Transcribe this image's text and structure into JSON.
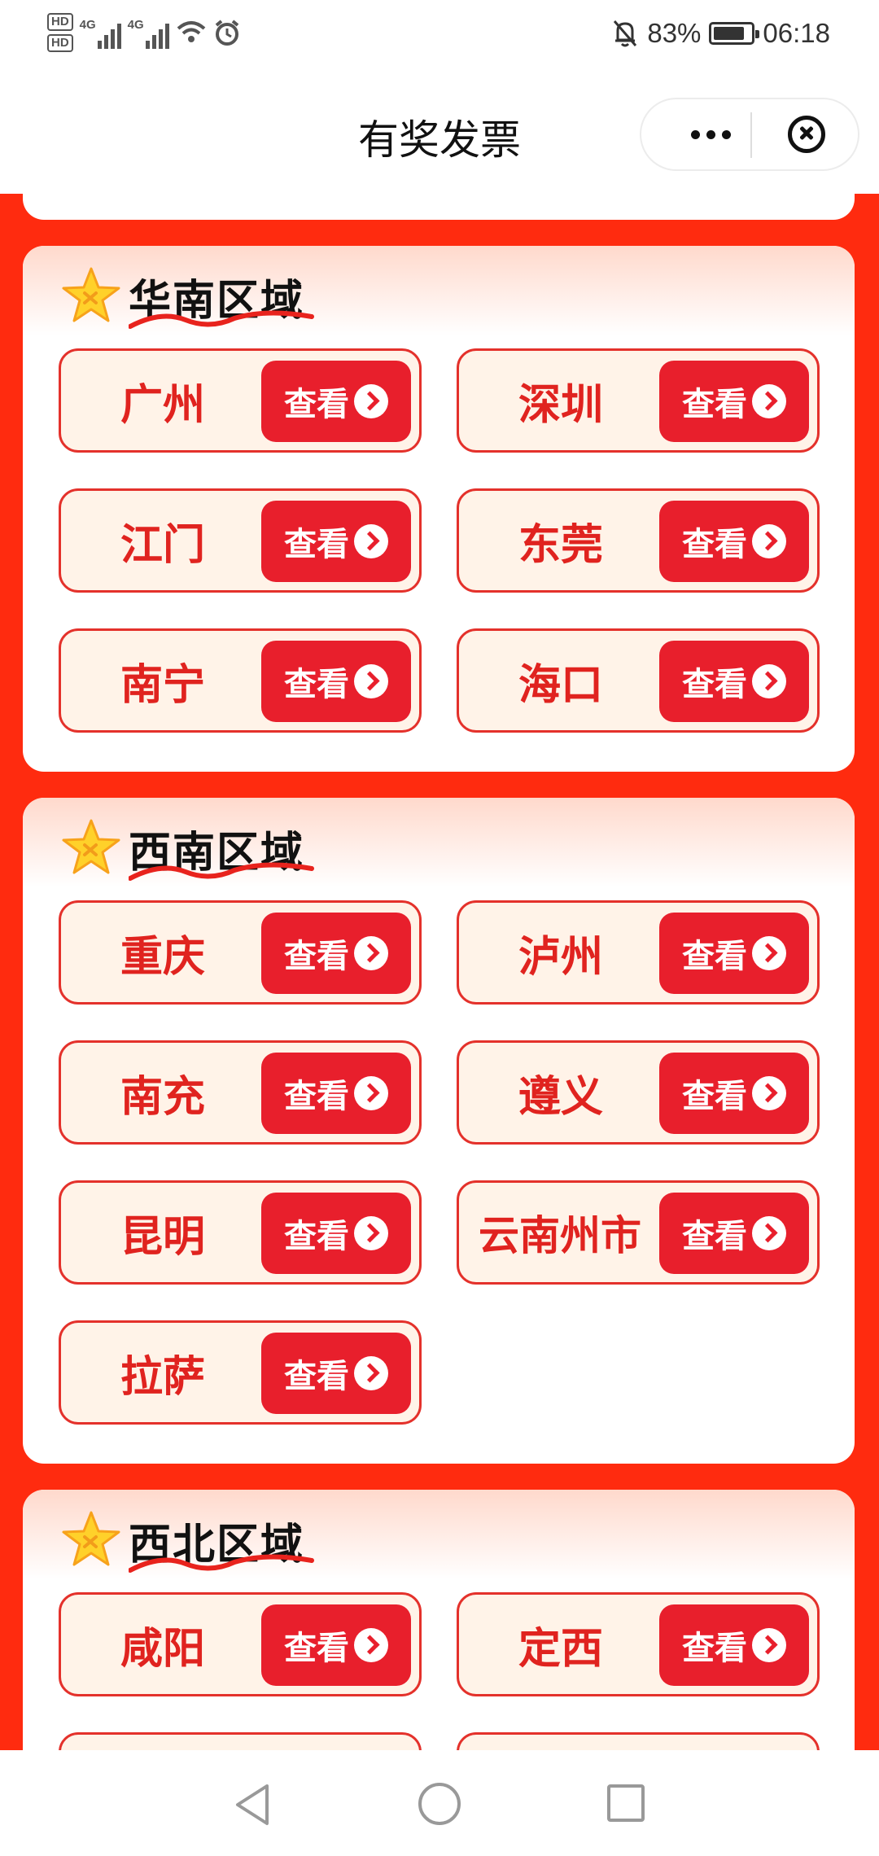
{
  "status_bar": {
    "hd1": "HD",
    "hd2": "HD",
    "net1": "4G",
    "net2": "4G",
    "battery_percent": "83%",
    "time": "06:18",
    "battery_level": 0.83
  },
  "title_bar": {
    "title": "有奖发票"
  },
  "sections": [
    {
      "title": "华南区域",
      "cities": [
        {
          "name": "广州",
          "button": "查看"
        },
        {
          "name": "深圳",
          "button": "查看"
        },
        {
          "name": "江门",
          "button": "查看"
        },
        {
          "name": "东莞",
          "button": "查看"
        },
        {
          "name": "南宁",
          "button": "查看"
        },
        {
          "name": "海口",
          "button": "查看"
        }
      ]
    },
    {
      "title": "西南区域",
      "cities": [
        {
          "name": "重庆",
          "button": "查看"
        },
        {
          "name": "泸州",
          "button": "查看"
        },
        {
          "name": "南充",
          "button": "查看"
        },
        {
          "name": "遵义",
          "button": "查看"
        },
        {
          "name": "昆明",
          "button": "查看"
        },
        {
          "name": "云南州市",
          "button": "查看"
        },
        {
          "name": "拉萨",
          "button": "查看"
        }
      ]
    },
    {
      "title": "西北区域",
      "cities": [
        {
          "name": "咸阳",
          "button": "查看"
        },
        {
          "name": "定西",
          "button": "查看"
        }
      ]
    }
  ],
  "colors": {
    "page_background": "#ff2b0f",
    "accent_red": "#e81f2c",
    "city_text": "#e0231f",
    "city_card_bg": "#fff3e8"
  }
}
